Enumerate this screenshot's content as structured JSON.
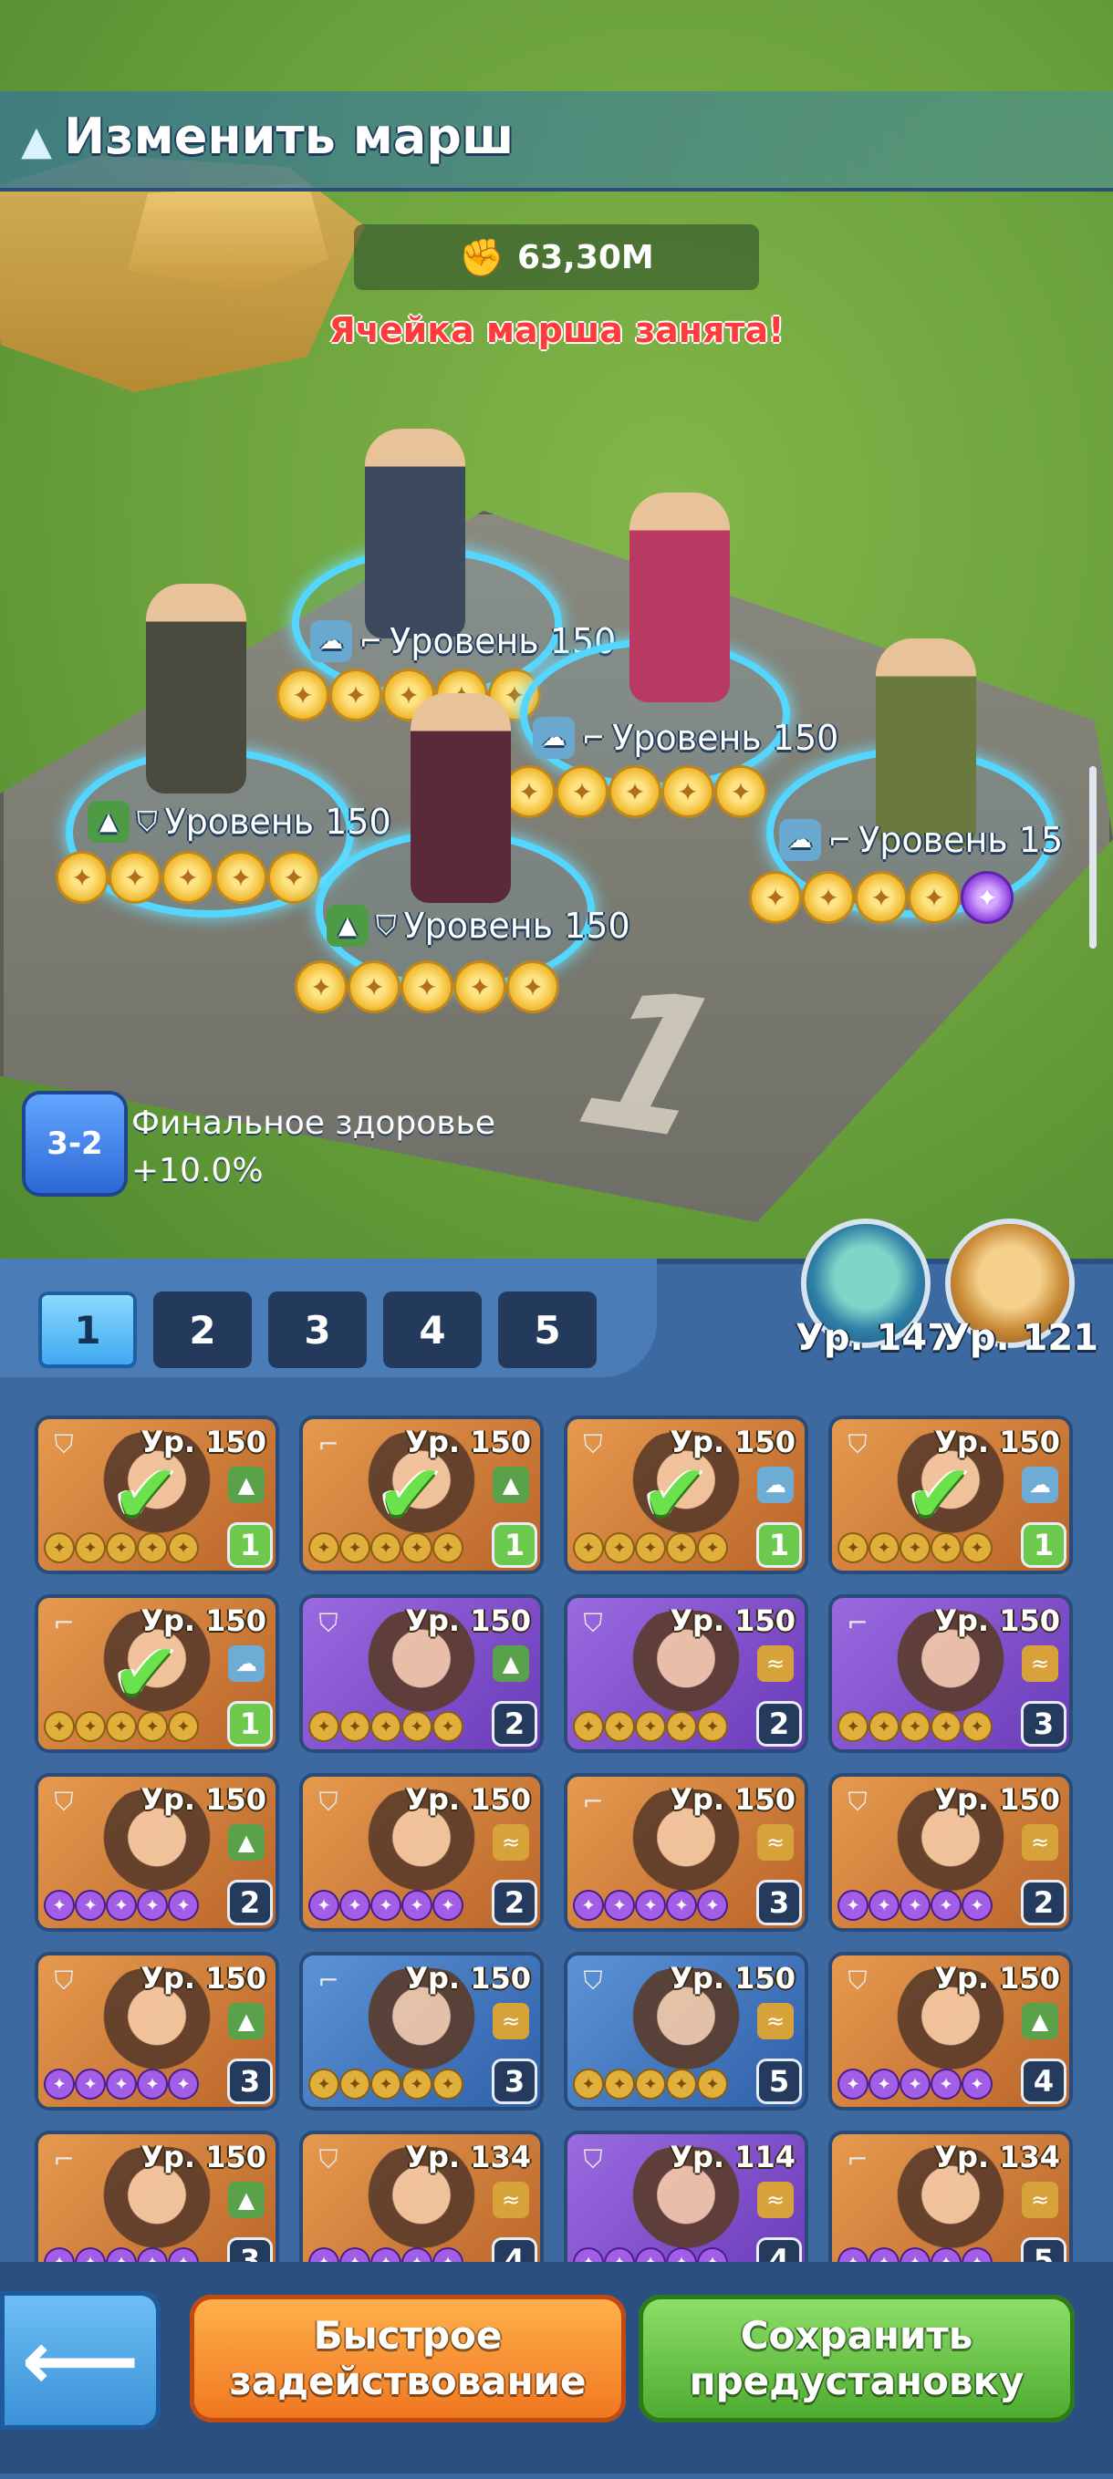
{
  "header": {
    "title": "Изменить марш",
    "power": "63,30M",
    "warning": "Ячейка марша занята!"
  },
  "field_slots": [
    {
      "label": "Уровень 150",
      "faction": "blue",
      "role": "gun",
      "stars": 5,
      "purple_stars": 0
    },
    {
      "label": "Уровень 150",
      "faction": "blue",
      "role": "gun",
      "stars": 5,
      "purple_stars": 0
    },
    {
      "label": "Уровень 150",
      "faction": "green",
      "role": "shield",
      "stars": 5,
      "purple_stars": 0
    },
    {
      "label": "Уровень 150",
      "faction": "green",
      "role": "shield",
      "stars": 5,
      "purple_stars": 0
    },
    {
      "label": "Уровень 15",
      "faction": "blue",
      "role": "gun",
      "stars": 4,
      "purple_stars": 1
    }
  ],
  "buff": {
    "icon_text": "3-2",
    "line1": "Финальное здоровье",
    "line2": "+10.0%"
  },
  "pets": [
    {
      "label": "Ур. 147"
    },
    {
      "label": "Ур. 121"
    }
  ],
  "tabs": [
    "1",
    "2",
    "3",
    "4",
    "5"
  ],
  "active_tab": "1",
  "heroes": [
    {
      "lvl": "Ур. 150",
      "count": "1",
      "bg": "orange",
      "fac": "green",
      "stars": "gold",
      "used": true
    },
    {
      "lvl": "Ур. 150",
      "count": "1",
      "bg": "orange",
      "fac": "green",
      "stars": "gold",
      "used": true
    },
    {
      "lvl": "Ур. 150",
      "count": "1",
      "bg": "orange",
      "fac": "blue",
      "stars": "gold",
      "used": true
    },
    {
      "lvl": "Ур. 150",
      "count": "1",
      "bg": "orange",
      "fac": "blue",
      "stars": "gold",
      "used": true
    },
    {
      "lvl": "Ур. 150",
      "count": "1",
      "bg": "orange",
      "fac": "blue",
      "stars": "gold",
      "used": true
    },
    {
      "lvl": "Ур. 150",
      "count": "2",
      "bg": "purple",
      "fac": "green",
      "stars": "gold",
      "used": false
    },
    {
      "lvl": "Ур. 150",
      "count": "2",
      "bg": "purple",
      "fac": "gold",
      "stars": "gold",
      "used": false
    },
    {
      "lvl": "Ур. 150",
      "count": "3",
      "bg": "purple",
      "fac": "gold",
      "stars": "gold",
      "used": false
    },
    {
      "lvl": "Ур. 150",
      "count": "2",
      "bg": "orange",
      "fac": "green",
      "stars": "purple",
      "used": false
    },
    {
      "lvl": "Ур. 150",
      "count": "2",
      "bg": "orange",
      "fac": "gold",
      "stars": "purple",
      "used": false
    },
    {
      "lvl": "Ур. 150",
      "count": "3",
      "bg": "orange",
      "fac": "gold",
      "stars": "purple",
      "used": false
    },
    {
      "lvl": "Ур. 150",
      "count": "2",
      "bg": "orange",
      "fac": "gold",
      "stars": "purple",
      "used": false
    },
    {
      "lvl": "Ур. 150",
      "count": "3",
      "bg": "orange",
      "fac": "green",
      "stars": "purple",
      "used": false
    },
    {
      "lvl": "Ур. 150",
      "count": "3",
      "bg": "blue",
      "fac": "gold",
      "stars": "gold",
      "used": false
    },
    {
      "lvl": "Ур. 150",
      "count": "5",
      "bg": "blue",
      "fac": "gold",
      "stars": "gold",
      "used": false
    },
    {
      "lvl": "Ур. 150",
      "count": "4",
      "bg": "orange",
      "fac": "green",
      "stars": "purple",
      "used": false
    },
    {
      "lvl": "Ур. 150",
      "count": "3",
      "bg": "orange",
      "fac": "green",
      "stars": "purple",
      "used": false
    },
    {
      "lvl": "Ур. 134",
      "count": "4",
      "bg": "orange",
      "fac": "gold",
      "stars": "purple",
      "used": false
    },
    {
      "lvl": "Ур. 114",
      "count": "4",
      "bg": "purple",
      "fac": "gold",
      "stars": "purple",
      "used": false
    },
    {
      "lvl": "Ур. 134",
      "count": "5",
      "bg": "orange",
      "fac": "gold",
      "stars": "purple",
      "used": false
    }
  ],
  "buttons": {
    "back": "⟵",
    "quick_deploy": "Быстрое задействование",
    "save_preset": "Сохранить предустановку"
  }
}
